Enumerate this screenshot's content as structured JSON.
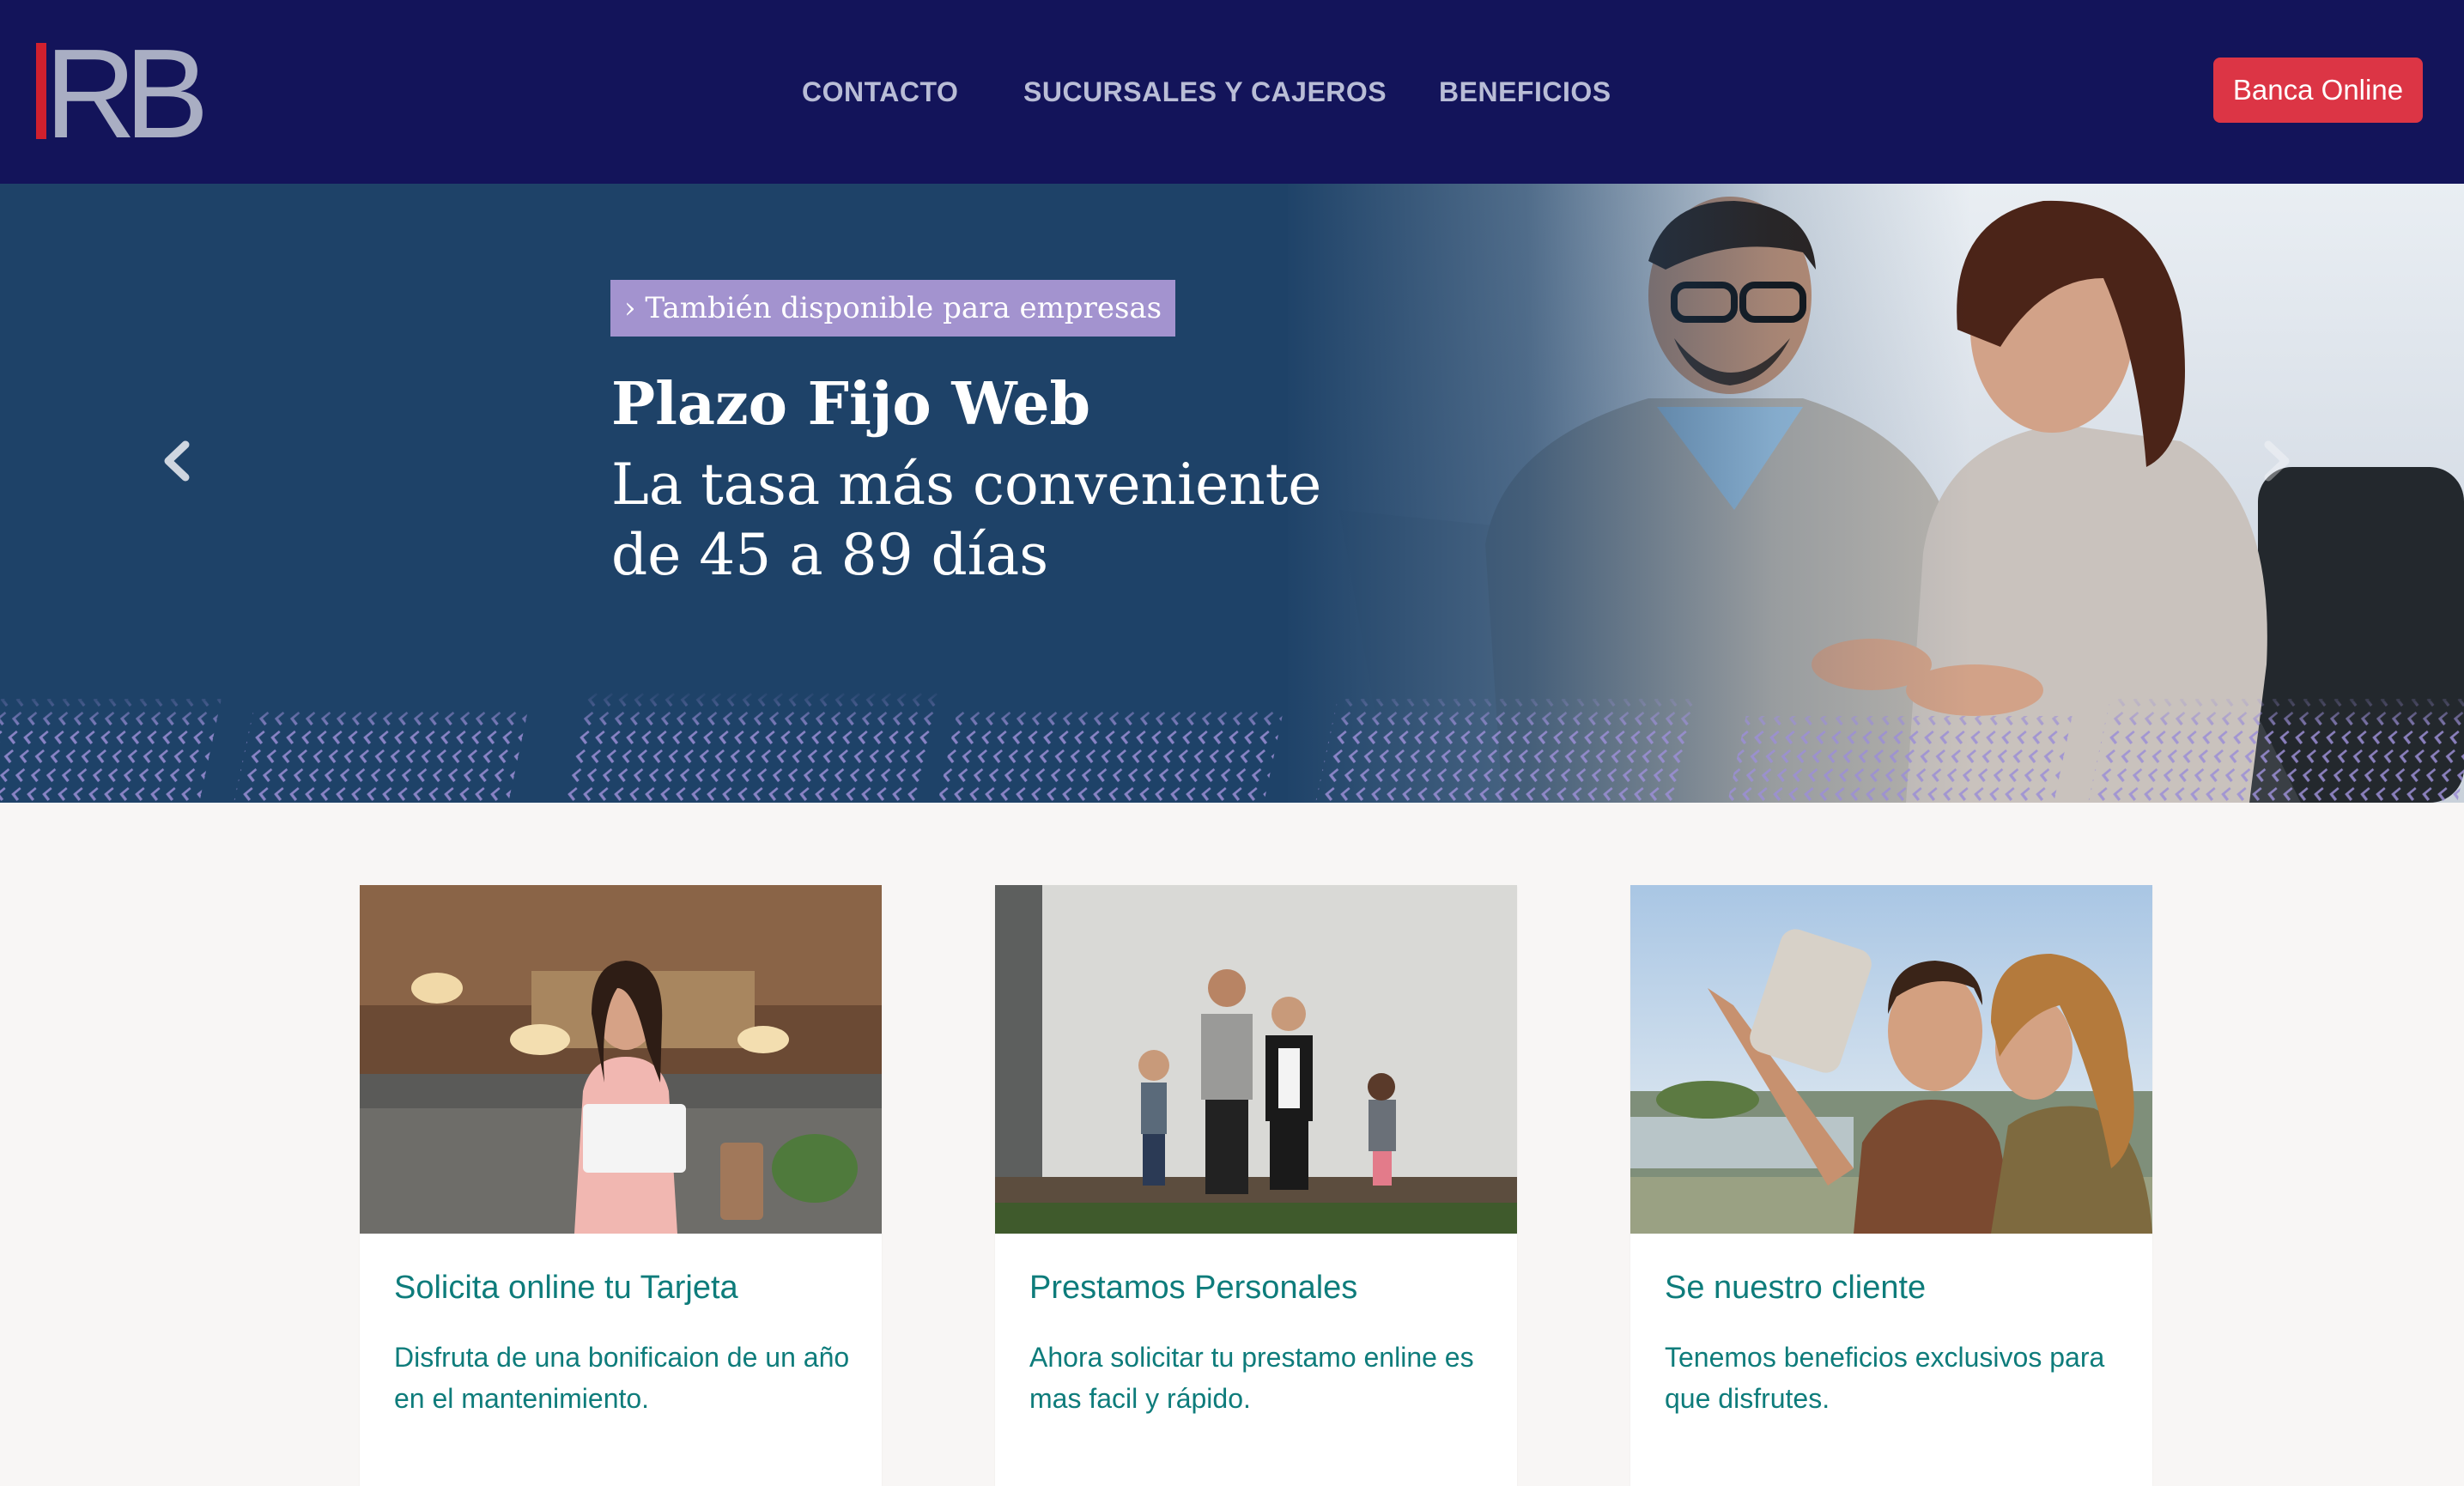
{
  "header": {
    "logo_text": "RB",
    "nav": [
      "CONTACTO",
      "SUCURSALES Y CAJEROS",
      "BENEFICIOS"
    ],
    "cta_label": "Banca Online"
  },
  "hero": {
    "tag": "› También disponible para empresas",
    "title": "Plazo Fijo Web",
    "subtitle": "La tasa más conveniente de 45 a 89 días"
  },
  "cards": [
    {
      "title": "Solicita online tu Tarjeta",
      "text": "Disfruta de una bonificaion de un año en el mantenimiento."
    },
    {
      "title": "Prestamos Personales",
      "text": "Ahora solicitar tu prestamo enline es mas facil y rápido."
    },
    {
      "title": "Se nuestro cliente",
      "text": "Tenemos beneficios exclusivos para que disfrutes."
    }
  ],
  "colors": {
    "navbar": "#13145a",
    "cta": "#dc3545",
    "hero_bg": "#1e4268",
    "hero_tag": "#a393cf",
    "card_text": "#0e7c7b",
    "page_bg": "#f8f6f5"
  }
}
